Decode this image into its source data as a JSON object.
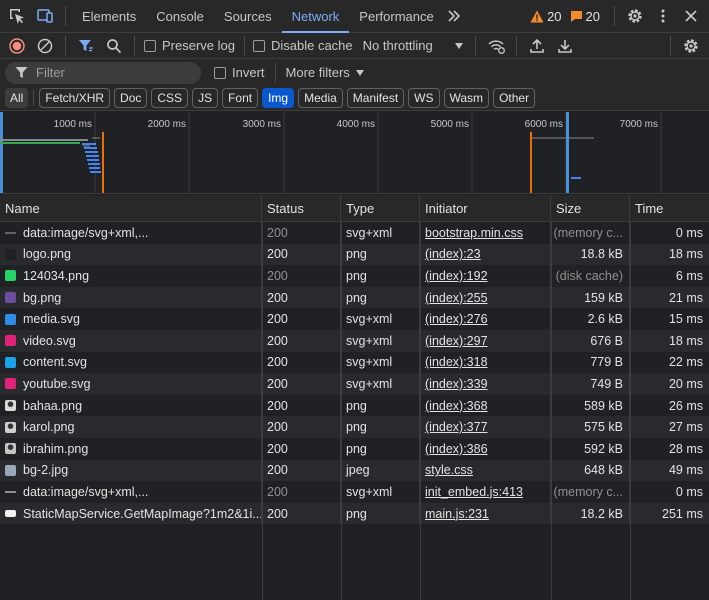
{
  "tabs": [
    {
      "label": "Elements"
    },
    {
      "label": "Console"
    },
    {
      "label": "Sources"
    },
    {
      "label": "Network"
    },
    {
      "label": "Performance"
    }
  ],
  "active_tab": "Network",
  "counters": {
    "warnings": "20",
    "issues": "20"
  },
  "toolbar": {
    "preserve_log": "Preserve log",
    "disable_cache": "Disable cache",
    "throttling": "No throttling"
  },
  "filter": {
    "placeholder": "Filter",
    "invert": "Invert",
    "more_filters": "More filters"
  },
  "type_filters": [
    "All",
    "Fetch/XHR",
    "Doc",
    "CSS",
    "JS",
    "Font",
    "Img",
    "Media",
    "Manifest",
    "WS",
    "Wasm",
    "Other"
  ],
  "active_type_filter": "Img",
  "timeline_ticks": [
    "1000 ms",
    "2000 ms",
    "3000 ms",
    "4000 ms",
    "5000 ms",
    "6000 ms",
    "7000 ms"
  ],
  "columns": {
    "name": "Name",
    "status": "Status",
    "type": "Type",
    "initiator": "Initiator",
    "size": "Size",
    "time": "Time"
  },
  "requests": [
    {
      "name": "data:image/svg+xml,...",
      "status": "200",
      "type": "svg+xml",
      "initiator": "bootstrap.min.css",
      "size": "(memory c...",
      "time": "0 ms",
      "icon": "data-dash-icon",
      "icon_color": "#5f6368",
      "cached": true
    },
    {
      "name": "logo.png",
      "status": "200",
      "type": "png",
      "initiator": "(index):23",
      "size": "18.8 kB",
      "time": "18 ms",
      "icon": "logo-thumb-icon",
      "icon_color": "#202124",
      "cached": false
    },
    {
      "name": "124034.png",
      "status": "200",
      "type": "png",
      "initiator": "(index):192",
      "size": "(disk cache)",
      "time": "6 ms",
      "icon": "whatsapp-thumb-icon",
      "icon_color": "#25d366",
      "cached": true
    },
    {
      "name": "bg.png",
      "status": "200",
      "type": "png",
      "initiator": "(index):255",
      "size": "159 kB",
      "time": "21 ms",
      "icon": "bg-thumb-icon",
      "icon_color": "#6d4c9e",
      "cached": false
    },
    {
      "name": "media.svg",
      "status": "200",
      "type": "svg+xml",
      "initiator": "(index):276",
      "size": "2.6 kB",
      "time": "15 ms",
      "icon": "people-thumb-icon",
      "icon_color": "#2e8de8",
      "cached": false
    },
    {
      "name": "video.svg",
      "status": "200",
      "type": "svg+xml",
      "initiator": "(index):297",
      "size": "676 B",
      "time": "18 ms",
      "icon": "video-thumb-icon",
      "icon_color": "#e2227a",
      "cached": false
    },
    {
      "name": "content.svg",
      "status": "200",
      "type": "svg+xml",
      "initiator": "(index):318",
      "size": "779 B",
      "time": "22 ms",
      "icon": "content-thumb-icon",
      "icon_color": "#1aa3e8",
      "cached": false
    },
    {
      "name": "youtube.svg",
      "status": "200",
      "type": "svg+xml",
      "initiator": "(index):339",
      "size": "749 B",
      "time": "20 ms",
      "icon": "youtube-thumb-icon",
      "icon_color": "#e2227a",
      "cached": false
    },
    {
      "name": "bahaa.png",
      "status": "200",
      "type": "png",
      "initiator": "(index):368",
      "size": "589 kB",
      "time": "26 ms",
      "icon": "avatar-thumb-icon",
      "icon_color": "#d9d9d9",
      "cached": false
    },
    {
      "name": "karol.png",
      "status": "200",
      "type": "png",
      "initiator": "(index):377",
      "size": "575 kB",
      "time": "27 ms",
      "icon": "avatar-thumb-icon",
      "icon_color": "#cfcfcf",
      "cached": false
    },
    {
      "name": "ibrahim.png",
      "status": "200",
      "type": "png",
      "initiator": "(index):386",
      "size": "592 kB",
      "time": "28 ms",
      "icon": "avatar-thumb-icon",
      "icon_color": "#c4c4c4",
      "cached": false
    },
    {
      "name": "bg-2.jpg",
      "status": "200",
      "type": "jpeg",
      "initiator": "style.css",
      "size": "648 kB",
      "time": "49 ms",
      "icon": "landscape-thumb-icon",
      "icon_color": "#9aa7b8",
      "cached": false
    },
    {
      "name": "data:image/svg+xml,...",
      "status": "200",
      "type": "svg+xml",
      "initiator": "init_embed.js:413",
      "size": "(memory c...",
      "time": "0 ms",
      "icon": "data-dash-icon",
      "icon_color": "#8e918f",
      "cached": true
    },
    {
      "name": "StaticMapService.GetMapImage?1m2&1i...",
      "status": "200",
      "type": "png",
      "initiator": "main.js:231",
      "size": "18.2 kB",
      "time": "251 ms",
      "icon": "map-thumb-icon",
      "icon_color": "#f1f1f1",
      "cached": false
    }
  ]
}
